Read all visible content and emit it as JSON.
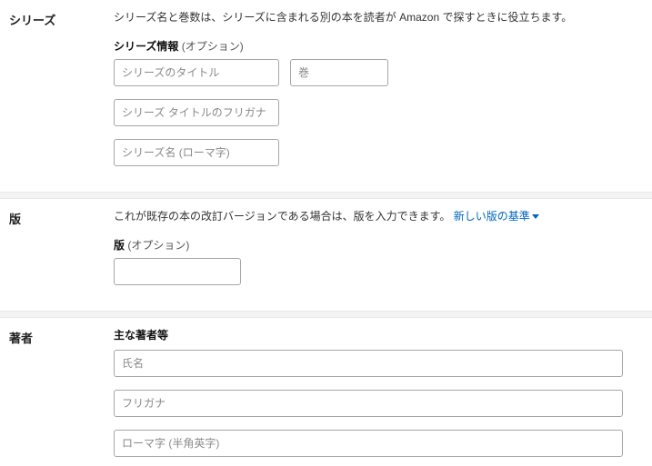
{
  "series": {
    "heading": "シリーズ",
    "description": "シリーズ名と巻数は、シリーズに含まれる別の本を読者が Amazon で探すときに役立ちます。",
    "info_label": "シリーズ情報",
    "optional": " (オプション)",
    "title_placeholder": "シリーズのタイトル",
    "volume_placeholder": "巻",
    "furigana_placeholder": "シリーズ タイトルのフリガナ",
    "romaji_placeholder": "シリーズ名 (ローマ字)"
  },
  "edition": {
    "heading": "版",
    "description_prefix": "これが既存の本の改訂バージョンである場合は、版を入力できます。 ",
    "link_text": "新しい版の基準",
    "field_label": "版",
    "optional": " (オプション)"
  },
  "author": {
    "heading": "著者",
    "primary_label": "主な著者等",
    "name_placeholder": "氏名",
    "furigana_placeholder": "フリガナ",
    "romaji_placeholder": "ローマ字 (半角英字)"
  }
}
